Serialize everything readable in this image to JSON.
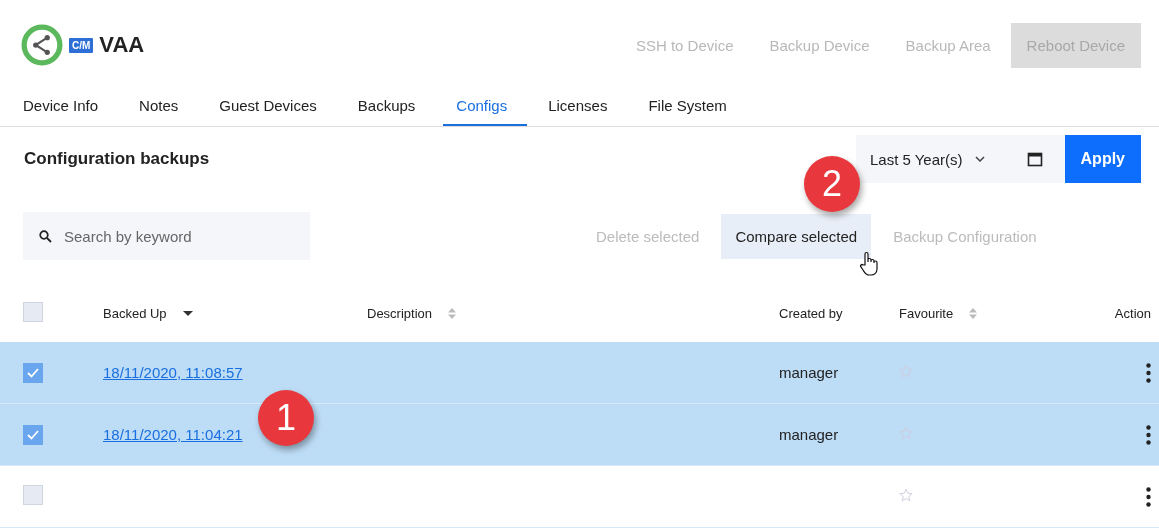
{
  "header": {
    "badge": "C/M",
    "title": "VAA",
    "actions": [
      {
        "label": "SSH to Device",
        "disabled": true,
        "kind": "link"
      },
      {
        "label": "Backup Device",
        "disabled": true,
        "kind": "link"
      },
      {
        "label": "Backup Area",
        "disabled": true,
        "kind": "link"
      },
      {
        "label": "Reboot Device",
        "disabled": true,
        "kind": "filled"
      }
    ]
  },
  "tabs": [
    {
      "label": "Device Info",
      "selected": false
    },
    {
      "label": "Notes",
      "selected": false
    },
    {
      "label": "Guest Devices",
      "selected": false
    },
    {
      "label": "Backups",
      "selected": false
    },
    {
      "label": "Configs",
      "selected": true
    },
    {
      "label": "Licenses",
      "selected": false
    },
    {
      "label": "File System",
      "selected": false
    }
  ],
  "section": {
    "title": "Configuration backups",
    "range": "Last 5 Year(s)",
    "apply": "Apply"
  },
  "search": {
    "placeholder": "Search by keyword"
  },
  "toolbar": [
    {
      "label": "Delete selected",
      "disabled": true,
      "hovered": false
    },
    {
      "label": "Compare selected",
      "disabled": false,
      "hovered": true
    },
    {
      "label": "Backup Configuration",
      "disabled": true,
      "hovered": false
    }
  ],
  "table": {
    "all_selected": false,
    "columns": [
      {
        "label": "Backed Up",
        "sortable": true,
        "sorted": true
      },
      {
        "label": "Description",
        "sortable": true,
        "sorted": false
      },
      {
        "label": "Created by",
        "sortable": false
      },
      {
        "label": "Favourite",
        "sortable": true,
        "sorted": false
      },
      {
        "label": "Action",
        "sortable": false
      }
    ],
    "rows": [
      {
        "selected": true,
        "backed_up": "18/11/2020, 11:08:57",
        "created_by": "manager",
        "favourite": false
      },
      {
        "selected": true,
        "backed_up": "18/11/2020, 11:04:21",
        "created_by": "manager",
        "favourite": false
      },
      {
        "selected": false,
        "favourite": false
      }
    ]
  },
  "callouts": {
    "rows": "1",
    "toolbar": "2"
  }
}
